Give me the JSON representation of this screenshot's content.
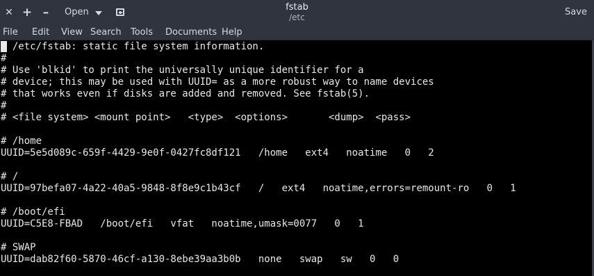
{
  "header": {
    "close_glyph": "✕",
    "add_glyph": "+",
    "minimize_glyph": "–",
    "open_label": "Open",
    "title": "fstab",
    "subtitle": "/etc",
    "save_label": "Save"
  },
  "menu": {
    "items": [
      "File",
      "Edit",
      "View",
      "Search",
      "Tools",
      "Documents",
      "Help"
    ]
  },
  "editor": {
    "lines": [
      "# /etc/fstab: static file system information.",
      "#",
      "# Use 'blkid' to print the universally unique identifier for a",
      "# device; this may be used with UUID= as a more robust way to name devices",
      "# that works even if disks are added and removed. See fstab(5).",
      "#",
      "# <file system> <mount point>   <type>  <options>       <dump>  <pass>",
      "",
      "# /home",
      "UUID=5e5d089c-659f-4429-9e0f-0427fc8df121   /home   ext4   noatime   0   2",
      "",
      "# /",
      "UUID=97befa07-4a22-40a5-9848-8f8e9c1b43cf   /   ext4   noatime,errors=remount-ro   0   1",
      "",
      "# /boot/efi",
      "UUID=C5E8-FBAD   /boot/efi   vfat   noatime,umask=0077   0   1",
      "",
      "# SWAP",
      "UUID=dab82f60-5870-46cf-a130-8ebe39aa3b0b   none   swap   sw   0   0"
    ]
  }
}
